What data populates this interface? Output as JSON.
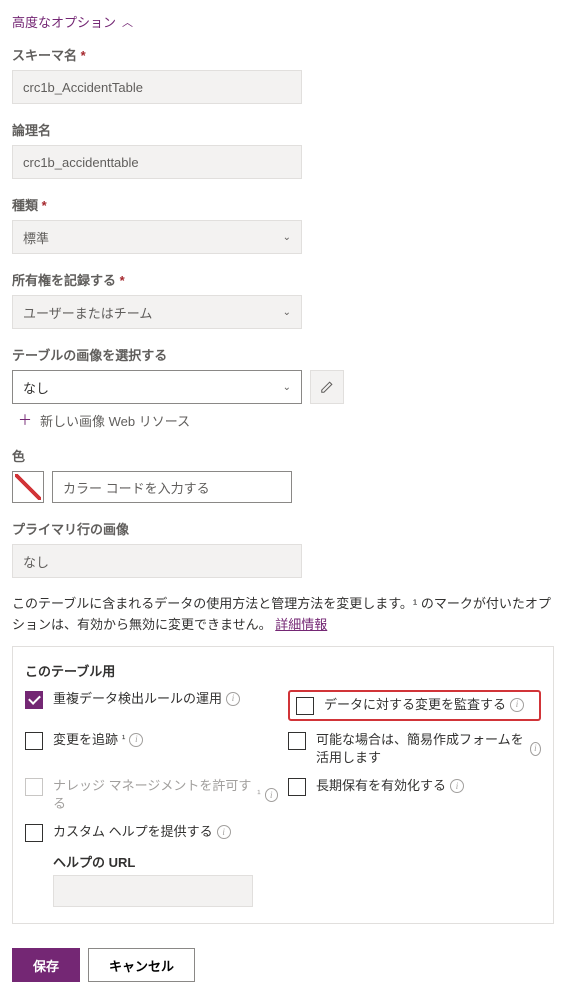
{
  "header": {
    "advanced": "高度なオプション"
  },
  "fields": {
    "schemaName": {
      "label": "スキーマ名",
      "value": "crc1b_AccidentTable"
    },
    "logicalName": {
      "label": "論理名",
      "value": "crc1b_accidenttable"
    },
    "kind": {
      "label": "種類",
      "value": "標準"
    },
    "ownership": {
      "label": "所有権を記録する",
      "value": "ユーザーまたはチーム"
    },
    "image": {
      "label": "テーブルの画像を選択する",
      "value": "なし",
      "addNew": "新しい画像 Web リソース"
    },
    "color": {
      "label": "色",
      "placeholder": "カラー コードを入力する"
    },
    "primaryImage": {
      "label": "プライマリ行の画像",
      "value": "なし"
    }
  },
  "note": {
    "text": "このテーブルに含まれるデータの使用方法と管理方法を変更します。¹ のマークが付いたオプションは、有効から無効に変更できません。",
    "link": "詳細情報"
  },
  "panel": {
    "title": "このテーブル用",
    "items": {
      "dedupe": {
        "label": "重複データ検出ルールの運用"
      },
      "audit": {
        "label": "データに対する変更を監査する"
      },
      "track": {
        "label": "変更を追跡"
      },
      "quick": {
        "label": "可能な場合は、簡易作成フォームを活用します"
      },
      "knowledge": {
        "label": "ナレッジ マネージメントを許可する"
      },
      "retain": {
        "label": "長期保有を有効化する"
      },
      "help": {
        "label": "カスタム ヘルプを提供する"
      }
    },
    "helpUrl": "ヘルプの URL"
  },
  "actions": {
    "save": "保存",
    "cancel": "キャンセル"
  }
}
